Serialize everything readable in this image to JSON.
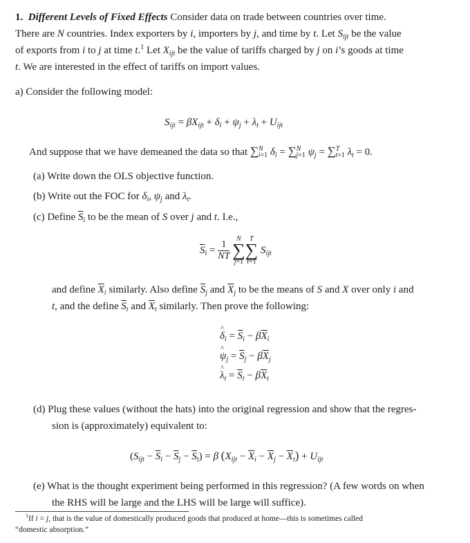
{
  "problem": {
    "number": "1.",
    "title": "Different Levels of Fixed Effects",
    "intro_lines": [
      "Consider data on trade between countries over time.",
      "There are N countries. Index exporters by i, importers by j, and time by t. Let S_ijt be the value",
      "of exports from i to j at time t.1 Let X_ijt be the value of tariffs charged by j on i's goods at time",
      "t. We are interested in the effect of tariffs on import values."
    ],
    "intro": {
      "l1": "Consider data on trade between countries over time.",
      "l2a": "There are ",
      "l2b": " countries. Index exporters by ",
      "l2c": ", importers by ",
      "l2d": ", and time by ",
      "l2e": ". Let ",
      "l2f": " be the value",
      "l3a": "of exports from ",
      "l3b": " to ",
      "l3c": " at time ",
      "l3d": " Let ",
      "l3e": " be the value of tariffs charged by ",
      "l3f": " on ",
      "l3g": "’s goods at time",
      "l4": ". We are interested in the effect of tariffs on import values."
    }
  },
  "part_a": {
    "label": "a)",
    "text": "Consider the following model:",
    "model_equation": "S_ijt = βX_ijt + δ_i + ψ_j + λ_t + U_ijt",
    "demean_text": "And suppose that we have demeaned the data so that",
    "demean_condition": "Σ_{i=1}^N δ_i = Σ_{j=1}^N ψ_j = Σ_{t=1}^T λ_t = 0.",
    "subparts": [
      {
        "label": "(a)",
        "text": "Write down the OLS objective function."
      },
      {
        "label": "(b)",
        "text": "Write out the FOC for δ_i, ψ_j and λ_t."
      },
      {
        "label": "(c)",
        "text": "Define S̄_i to be the mean of S over j and t. I.e.,"
      },
      {
        "label": "(d)",
        "text": "Plug these values (without the hats) into the original regression and show that the regression is (approximately) equivalent to:"
      },
      {
        "label": "(e)",
        "text": "What is the thought experiment being performed in this regression? (A few words on when the RHS will be large and the LHS will be large will suffice)."
      }
    ],
    "c_mean_equation": "S̄_i = (1/NT) Σ_{j=1}^N Σ_{t=1}^T S_ijt",
    "c_continuation": [
      "and define X̄_i similarly. Also define S̄_j and X̄_j to be the means of S and X over only i and",
      "t, and the define S̄_t and X̄_t similarly. Then prove the following:"
    ],
    "c_results": [
      "δ̂_i = S̄_i − βX̄_i",
      "ψ̂_j = S̄_j − βX̄_j",
      "λ̂_t = S̄_t − βX̄_t"
    ],
    "d_equation": "(S_ijt − S̄_i − S̄_j − S̄_t) = β (X_ijt − X̄_i − X̄_j − X̄_t) + U_ijt",
    "texts": {
      "a": "Write down the OLS objective function.",
      "b1": "Write out the FOC for ",
      "b2": " and ",
      "c1": "Define ",
      "c2": " to be the mean of ",
      "c3": " over ",
      "c4": " and ",
      "c5": ". I.e.,",
      "cc1a": "and define ",
      "cc1b": " similarly. Also define ",
      "cc1c": " and ",
      "cc1d": " to be the means of ",
      "cc1e": " and ",
      "cc1f": " over only ",
      "cc1g": " and",
      "cc2a": ", and the define ",
      "cc2b": " and ",
      "cc2c": " similarly. Then prove the following:",
      "d1": "Plug these values (without the hats) into the original regression and show that the regres-",
      "d2": "sion is (approximately) equivalent to:",
      "e1": "What is the thought experiment being performed in this regression? (A few words on when",
      "e2": "the RHS will be large and the LHS will be large will suffice)."
    }
  },
  "footnote": {
    "marker": "1",
    "line1_a": "If ",
    "line1_b": ", that is the value of domestically produced goods that produced at home—this is sometimes called",
    "line2": "“domestic absorption.”",
    "full_text": "If i = j, that is the value of domestically produced goods that produced at home—this is sometimes called “domestic absorption.”"
  }
}
